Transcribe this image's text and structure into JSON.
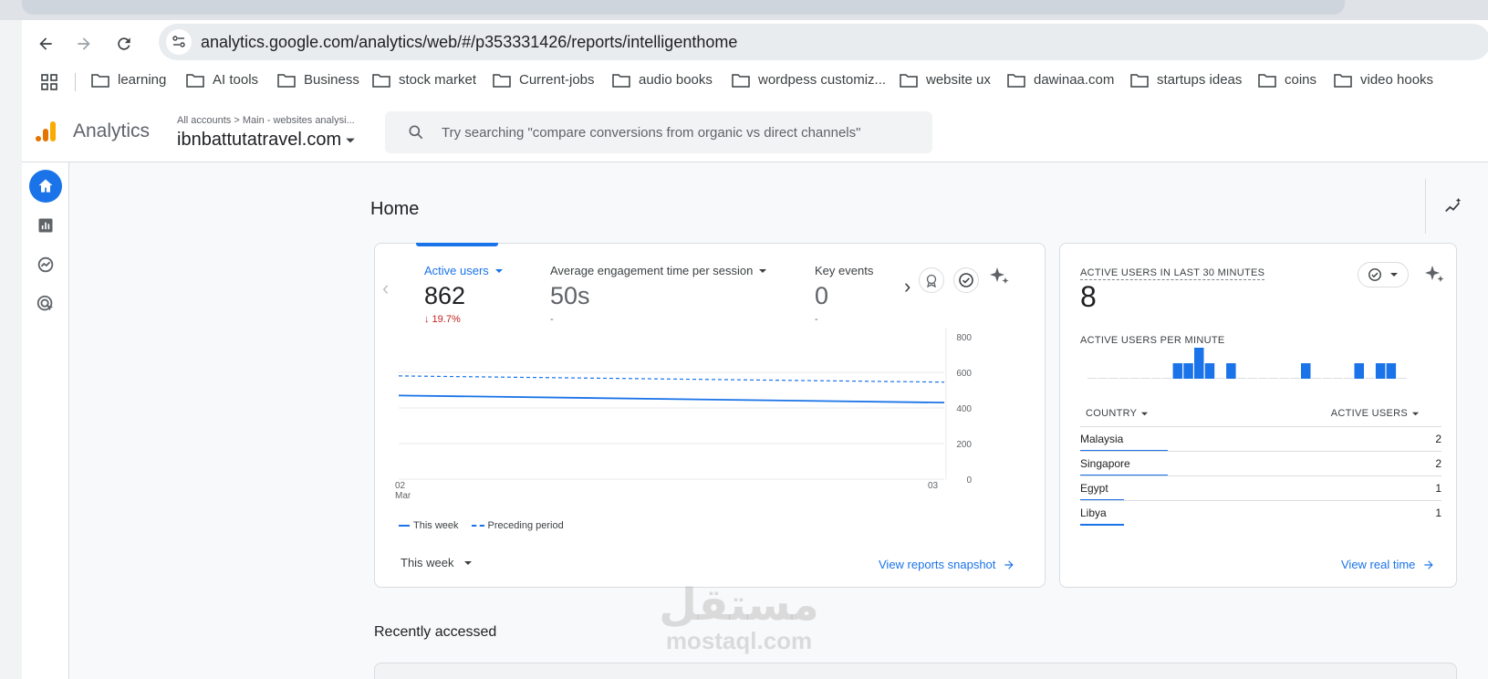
{
  "browser": {
    "url": "analytics.google.com/analytics/web/#/p353331426/reports/intelligenthome",
    "bookmarks": [
      "learning",
      "AI tools",
      "Business",
      "stock market",
      "Current-jobs",
      "audio books",
      "wordpess customiz...",
      "website ux",
      "dawinaa.com",
      "startups ideas",
      "coins",
      "video hooks"
    ]
  },
  "header": {
    "app_name": "Analytics",
    "breadcrumb": "All accounts > Main - websites analysi...",
    "property": "ibnbattutatravel.com",
    "search_placeholder": "Try searching \"compare conversions from organic vs direct channels\""
  },
  "page": {
    "title": "Home"
  },
  "overview_card": {
    "metrics": [
      {
        "label": "Active users",
        "value": "862",
        "delta": "↓ 19.7%"
      },
      {
        "label": "Average engagement time per session",
        "value": "50s",
        "delta": "-"
      },
      {
        "label": "Key events",
        "value": "0",
        "delta": "-"
      }
    ],
    "legend_this_week": "This week",
    "legend_preceding": "Preceding period",
    "period_select": "This week",
    "link": "View reports snapshot"
  },
  "chart_data": {
    "type": "line",
    "x": [
      "02 Mar",
      "03"
    ],
    "xtick_main": [
      "02",
      "03"
    ],
    "xtick_sub": [
      "Mar",
      ""
    ],
    "yticks": [
      "800",
      "600",
      "400",
      "200",
      "0"
    ],
    "ylim": [
      0,
      800
    ],
    "series": [
      {
        "name": "This week",
        "values": [
          470,
          430
        ],
        "style": "solid"
      },
      {
        "name": "Preceding period",
        "values": [
          580,
          545
        ],
        "style": "dashed"
      }
    ],
    "grid": true
  },
  "realtime_card": {
    "title": "ACTIVE USERS IN LAST 30 MINUTES",
    "value": "8",
    "subtitle": "ACTIVE USERS PER MINUTE",
    "per_minute": [
      0,
      0,
      0,
      0,
      0,
      0,
      0,
      0,
      1,
      1,
      2,
      1,
      0,
      1,
      0,
      0,
      0,
      0,
      0,
      0,
      1,
      0,
      0,
      0,
      0,
      1,
      0,
      1,
      1,
      0
    ],
    "col_country": "COUNTRY",
    "col_users": "ACTIVE USERS",
    "rows": [
      {
        "country": "Malaysia",
        "users": "2",
        "share": 1.0
      },
      {
        "country": "Singapore",
        "users": "2",
        "share": 1.0
      },
      {
        "country": "Egypt",
        "users": "1",
        "share": 0.5
      },
      {
        "country": "Libya",
        "users": "1",
        "share": 0.5
      }
    ],
    "link": "View real time"
  },
  "recently_accessed": {
    "title": "Recently accessed"
  },
  "watermark": {
    "arabic": "مستقل",
    "latin": "mostaql.com"
  },
  "colors": {
    "accent": "#1a73e8",
    "negative": "#c5221f",
    "analytics_orange": "#f9ab00",
    "analytics_dark_orange": "#e37400"
  }
}
